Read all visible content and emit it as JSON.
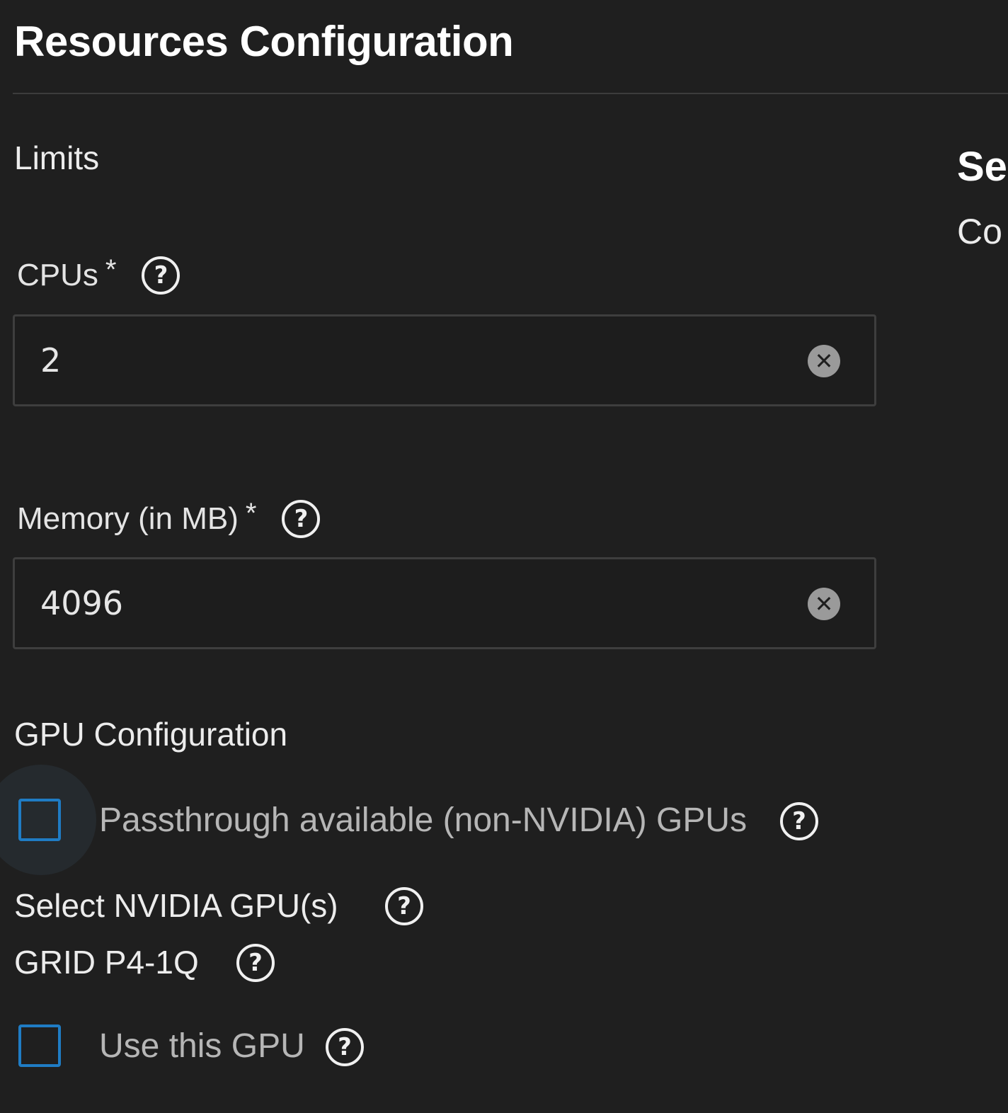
{
  "header": {
    "title": "Resources Configuration"
  },
  "side_panel": {
    "heading": "Se",
    "subtext": "Co"
  },
  "limits": {
    "heading": "Limits",
    "cpus": {
      "label": "CPUs",
      "required_mark": "*",
      "value": "2"
    },
    "memory": {
      "label": "Memory (in MB)",
      "required_mark": "*",
      "value": "4096"
    }
  },
  "gpu": {
    "heading": "GPU Configuration",
    "passthrough": {
      "label": "Passthrough available (non-NVIDIA) GPUs",
      "checked": false
    },
    "select_nvidia": {
      "label": "Select NVIDIA GPU(s)"
    },
    "device": {
      "name": "GRID P4-1Q",
      "use_label": "Use this GPU",
      "checked": false
    }
  },
  "icons": {
    "help": "help-circle-icon",
    "clear": "clear-circle-icon",
    "help_glyph": "?",
    "clear_glyph": "✕"
  },
  "colors": {
    "background": "#1f1f1f",
    "checkbox_border": "#1f7cc4",
    "input_border": "#3e3e3e"
  }
}
